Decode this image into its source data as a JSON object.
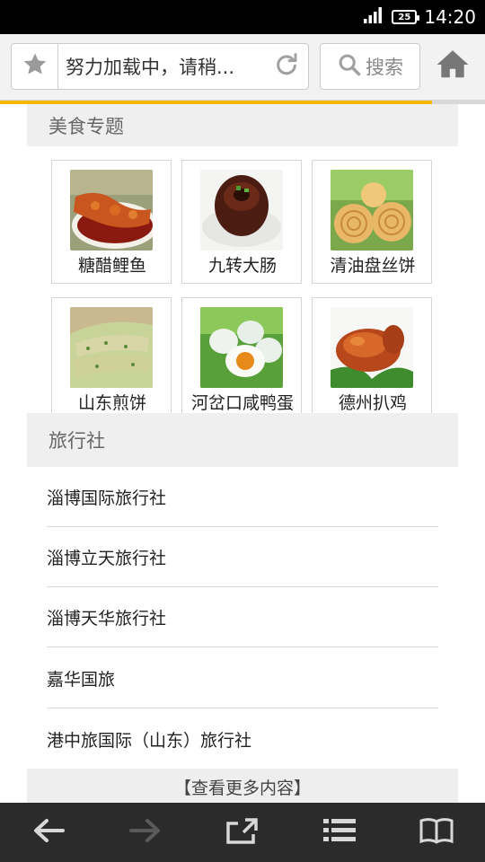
{
  "status_bar": {
    "battery_level": "25",
    "time": "14:20"
  },
  "browser": {
    "url_text": "努力加载中，请稍...",
    "search_label": "搜索",
    "load_progress_percent": 89,
    "icons": [
      "star-icon",
      "reload-icon",
      "search-icon",
      "home-icon"
    ],
    "accent_color": "#f5b800"
  },
  "food_section": {
    "title": "美食专题",
    "items": [
      {
        "label": "糖醋鲤鱼"
      },
      {
        "label": "九转大肠"
      },
      {
        "label": "清油盘丝饼"
      },
      {
        "label": "山东煎饼"
      },
      {
        "label": "河岔口咸鸭蛋"
      },
      {
        "label": "德州扒鸡"
      }
    ]
  },
  "agency_section": {
    "title": "旅行社",
    "items": [
      "淄博国际旅行社",
      "淄博立天旅行社",
      "淄博天华旅行社",
      "嘉华国旅",
      "港中旅国际（山东）旅行社"
    ],
    "more_label": "【查看更多内容】"
  },
  "bottom_nav": {
    "items": [
      "back-arrow-icon",
      "forward-arrow-icon",
      "share-icon",
      "menu-list-icon",
      "bookmarks-book-icon"
    ]
  }
}
